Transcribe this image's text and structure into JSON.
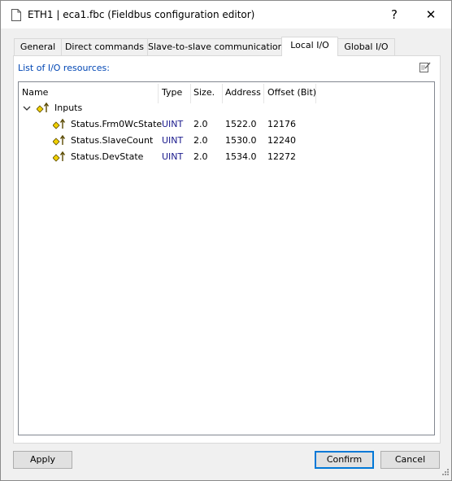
{
  "window": {
    "title": "ETH1 | eca1.fbc (Fieldbus configuration editor)",
    "help_label": "?",
    "close_label": "✕"
  },
  "tabs": [
    {
      "label": "General",
      "active": false
    },
    {
      "label": "Direct commands",
      "active": false
    },
    {
      "label": "Slave-to-slave communication",
      "active": false
    },
    {
      "label": "Local I/O",
      "active": true
    },
    {
      "label": "Global I/O",
      "active": false
    }
  ],
  "panel": {
    "list_label": "List of I/O resources:"
  },
  "table": {
    "headers": [
      "Name",
      "Type",
      "Size.",
      "Address",
      "Offset (Bit)"
    ],
    "group": {
      "label": "Inputs",
      "expanded": true
    },
    "rows": [
      {
        "name": "Status.Frm0WcState",
        "type": "UINT",
        "size": "2.0",
        "address": "1522.0",
        "offset": "12176"
      },
      {
        "name": "Status.SlaveCount",
        "type": "UINT",
        "size": "2.0",
        "address": "1530.0",
        "offset": "12240"
      },
      {
        "name": "Status.DevState",
        "type": "UINT",
        "size": "2.0",
        "address": "1534.0",
        "offset": "12272"
      }
    ]
  },
  "buttons": {
    "apply": "Apply",
    "confirm": "Confirm",
    "cancel": "Cancel"
  },
  "colors": {
    "accent": "#0078d7",
    "label_blue": "#0046b4",
    "type_blue": "#1a1a8c",
    "icon_yellow": "#f0d000"
  }
}
